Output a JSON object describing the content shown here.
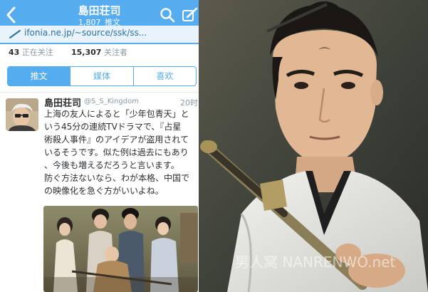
{
  "header": {
    "profile_name": "島田荘司",
    "tweet_count": "1,807",
    "tweet_count_label": "推文",
    "profile_url": "ifonia.ne.jp/~source/ssk/ss..."
  },
  "stats": {
    "following_count": "43",
    "following_label": "正在关注",
    "followers_count": "15,307",
    "followers_label": "关注者"
  },
  "tabs": [
    {
      "label": "推文",
      "active": true
    },
    {
      "label": "媒体",
      "active": false
    },
    {
      "label": "喜欢",
      "active": false
    }
  ],
  "tweet": {
    "author": "島田荘司",
    "handle": "@S_S_Kingdom",
    "time": "20时",
    "lines": [
      "上海の友人によると「少年包青天」と",
      "いう45分の連続TVドラマで、『占星",
      "術殺人事件』のアイデアが盗用されて",
      "いるそうです。似た例は過去にもあり",
      "、今後も増えるだろうと言います。",
      "防ぐ方法ないなら、わが本格、中国で",
      "の映像化を急ぐ方がいいよね。"
    ]
  },
  "watermark": "男人窝 NANRENWO.net",
  "colors": {
    "accent": "#55acee",
    "url_strip": "#e9f3fb"
  },
  "icons": {
    "back": "chevron-left-icon",
    "search": "search-icon",
    "compose": "compose-icon",
    "link": "link-icon"
  }
}
